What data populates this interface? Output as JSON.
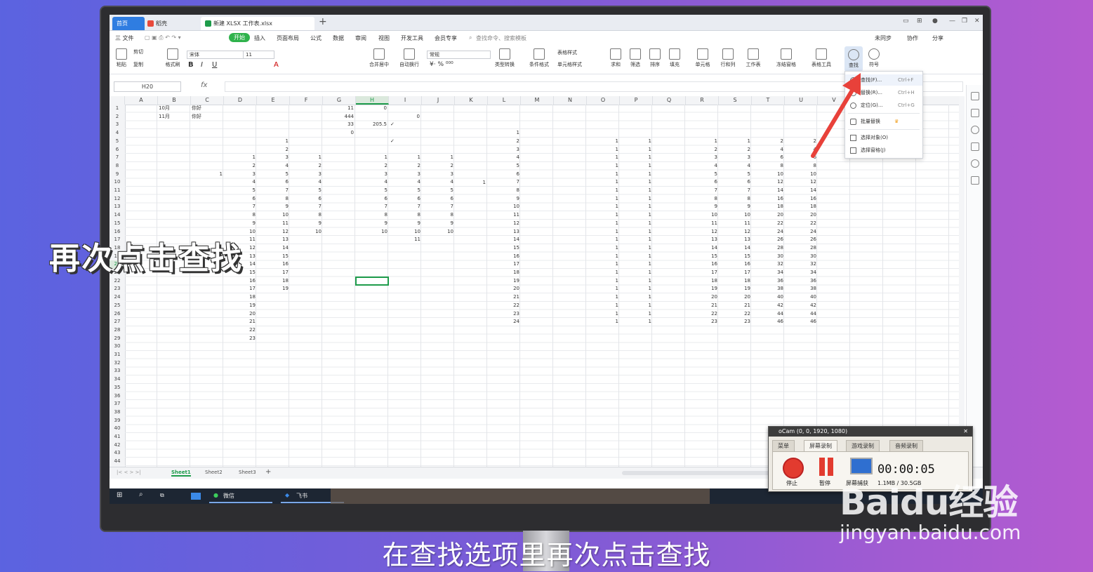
{
  "tabs": {
    "home": "首页",
    "tab2": "稻壳",
    "tab3": "新建 XLSX 工作表.xlsx"
  },
  "menu": {
    "file": "三 文件",
    "items": [
      "开始",
      "插入",
      "页面布局",
      "公式",
      "数据",
      "审阅",
      "视图",
      "开发工具",
      "会员专享"
    ],
    "search": "查找命令、搜索模板",
    "right": [
      "未同步",
      "协作",
      "分享"
    ]
  },
  "toolbar": {
    "paste": "粘贴",
    "cut": "剪切",
    "copy": "复制",
    "format_painter": "格式刷",
    "font": "宋体",
    "size": "11",
    "merge": "合并居中",
    "wrap": "自动换行",
    "number_format": "常规",
    "convert": "类型转换",
    "cond_format": "条件格式",
    "table_style": "表格样式",
    "cell_style": "单元格样式",
    "sum": "求和",
    "filter": "筛选",
    "sort": "排序",
    "fill": "填充",
    "cell": "单元格",
    "rowcol": "行和列",
    "sheet": "工作表",
    "freeze": "冻结窗格",
    "tools": "表格工具",
    "find": "查找",
    "symbol": "符号"
  },
  "formula": {
    "namebox": "H20",
    "fx": "fx"
  },
  "columns": [
    "A",
    "B",
    "C",
    "D",
    "E",
    "F",
    "G",
    "H",
    "I",
    "J",
    "K",
    "L",
    "M",
    "N",
    "O",
    "P",
    "Q",
    "R",
    "S",
    "T",
    "U",
    "V",
    "",
    "Y"
  ],
  "rows": [
    "1",
    "2",
    "3",
    "4",
    "5",
    "6",
    "7",
    "8",
    "9",
    "10",
    "11",
    "12",
    "13",
    "14",
    "15",
    "16",
    "17",
    "18",
    "19",
    "20",
    "21",
    "22",
    "23",
    "24",
    "25",
    "26",
    "27",
    "28",
    "29",
    "30",
    "31",
    "32",
    "33",
    "34",
    "35",
    "36",
    "37",
    "38",
    "39",
    "40",
    "41",
    "42",
    "43",
    "44"
  ],
  "cells": {
    "b1": "10月",
    "b2": "11月",
    "c1": "你好",
    "c2": "你好",
    "g1": "11",
    "g2": "444",
    "g3": "33",
    "g4": "0",
    "h1": "0",
    "h3": "205.5",
    "i2": "0",
    "check1": "✓",
    "check2": "✓",
    "c7": "1",
    "k8": "1"
  },
  "sheets": [
    "Sheet1",
    "Sheet2",
    "Sheet3"
  ],
  "dropdown": [
    {
      "label": "查找(F)...",
      "shortcut": "Ctrl+F"
    },
    {
      "label": "替换(R)...",
      "shortcut": "Ctrl+H"
    },
    {
      "label": "定位(G)...",
      "shortcut": "Ctrl+G"
    },
    {
      "label": "批量替换",
      "shortcut": ""
    },
    {
      "label": "选择对象(O)",
      "shortcut": ""
    },
    {
      "label": "选择窗格(J)",
      "shortcut": ""
    }
  ],
  "taskbar": {
    "wechat": "微信",
    "feishu": "飞书"
  },
  "ocam": {
    "title": "oCam (0, 0, 1920, 1080)",
    "tabs": [
      "菜单",
      "屏幕录制",
      "游戏录制",
      "音频录制"
    ],
    "stop": "停止",
    "pause": "暂停",
    "capture": "屏幕捕获",
    "timer": "00:00:05",
    "size": "1.1MB / 30.5GB"
  },
  "captions": {
    "left": "再次点击查找",
    "bottom": "在查找选项里再次点击查找"
  },
  "watermark": {
    "brand": "Baidu经验",
    "url": "jingyan.baidu.com"
  },
  "colors": {
    "accent_green": "#1e9c4b",
    "accent_blue": "#2f7de1",
    "arrow_red": "#e8413a"
  }
}
